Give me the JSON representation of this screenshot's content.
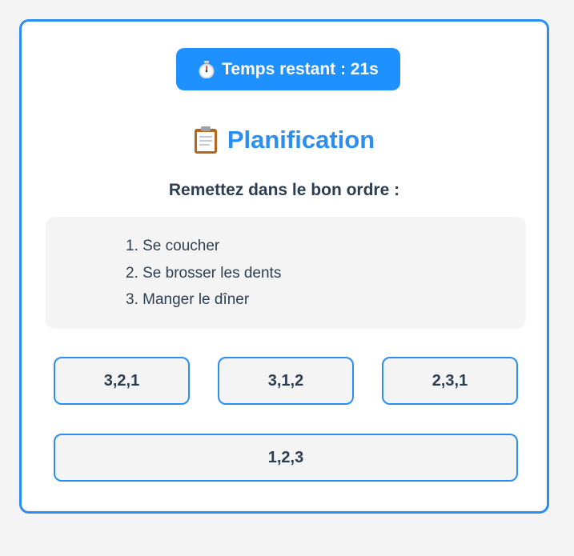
{
  "timer": {
    "icon": "stopwatch-icon",
    "label": "Temps restant : 21s"
  },
  "title": {
    "icon": "clipboard-icon",
    "text": "Planification"
  },
  "instruction": "Remettez dans le bon ordre :",
  "steps": [
    "1. Se coucher",
    "2. Se brosser les dents",
    "3. Manger le dîner"
  ],
  "options": [
    "3,2,1",
    "3,1,2",
    "2,3,1",
    "1,2,3"
  ],
  "colors": {
    "accent": "#2b8ef0",
    "timer_bg": "#1e90ff",
    "text": "#2c3e50",
    "page_bg": "#f4f4f4"
  }
}
